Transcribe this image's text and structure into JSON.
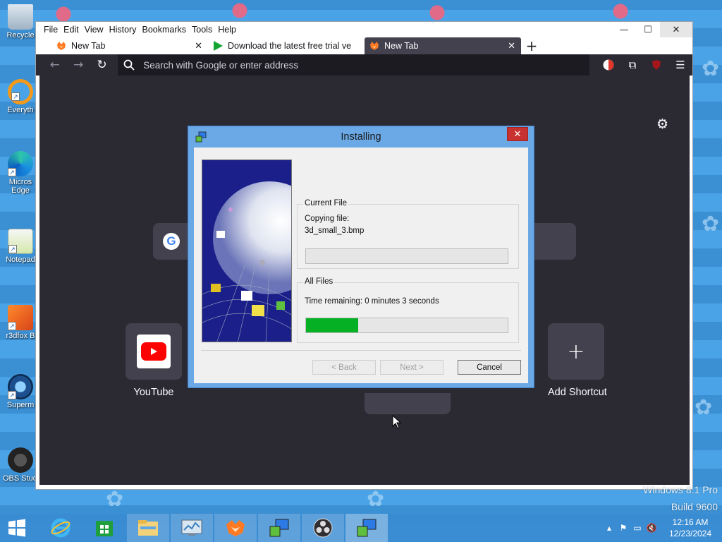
{
  "desktop": {
    "icons": [
      {
        "label": "Recycle",
        "icon": "recycle-bin-icon"
      },
      {
        "label": "Everyth",
        "icon": "everything-icon"
      },
      {
        "label": "Micros",
        "label2": "Edge",
        "icon": "edge-icon"
      },
      {
        "label": "Notepad",
        "icon": "notepad-icon"
      },
      {
        "label": "r3dfox B",
        "icon": "r3dfox-icon"
      },
      {
        "label": "Superm",
        "icon": "supermium-icon"
      },
      {
        "label": "OBS Studio",
        "icon": "obs-icon"
      }
    ],
    "watermark": {
      "line1": "Windows 8.1 Pro",
      "line2": "Build 9600"
    }
  },
  "browser": {
    "menu": [
      "File",
      "Edit",
      "View",
      "History",
      "Bookmarks",
      "Tools",
      "Help"
    ],
    "menu_access_keys": [
      "F",
      "E",
      "V",
      "s",
      "B",
      "T",
      "H"
    ],
    "tabs": [
      {
        "title": "New Tab",
        "favicon": "firefox-icon",
        "active": false
      },
      {
        "title": "Download the latest free trial ve",
        "favicon": "play-icon",
        "active": false
      },
      {
        "title": "New Tab",
        "favicon": "firefox-icon",
        "active": true
      }
    ],
    "urlbar_placeholder": "Search with Google or enter address",
    "newtab": {
      "shortcuts": [
        {
          "label": "YouTube"
        },
        {
          "label": "Add Shortcut"
        }
      ]
    }
  },
  "dialog": {
    "title": "Installing",
    "current_file_group": "Current File",
    "copying_label": "Copying file:",
    "filename": "3d_small_3.bmp",
    "current_progress": 0,
    "all_files_group": "All Files",
    "time_remaining": "Time remaining: 0 minutes 3 seconds",
    "overall_progress": 0.26,
    "buttons": {
      "back": "< Back",
      "next": "Next >",
      "cancel": "Cancel"
    }
  },
  "taskbar": {
    "items": [
      "internet-explorer-icon",
      "store-icon",
      "file-explorer-icon",
      "task-manager-icon",
      "r3dfox-icon",
      "installer-icon",
      "obs-icon",
      "installer-icon"
    ],
    "clock_time": "12:16 AM",
    "clock_date": "12/23/2024"
  },
  "colors": {
    "progress_fill": "#06b025",
    "browser_dark": "#2b2a33",
    "tab_active": "#42414d",
    "dialog_frame": "#6aa8e6"
  }
}
